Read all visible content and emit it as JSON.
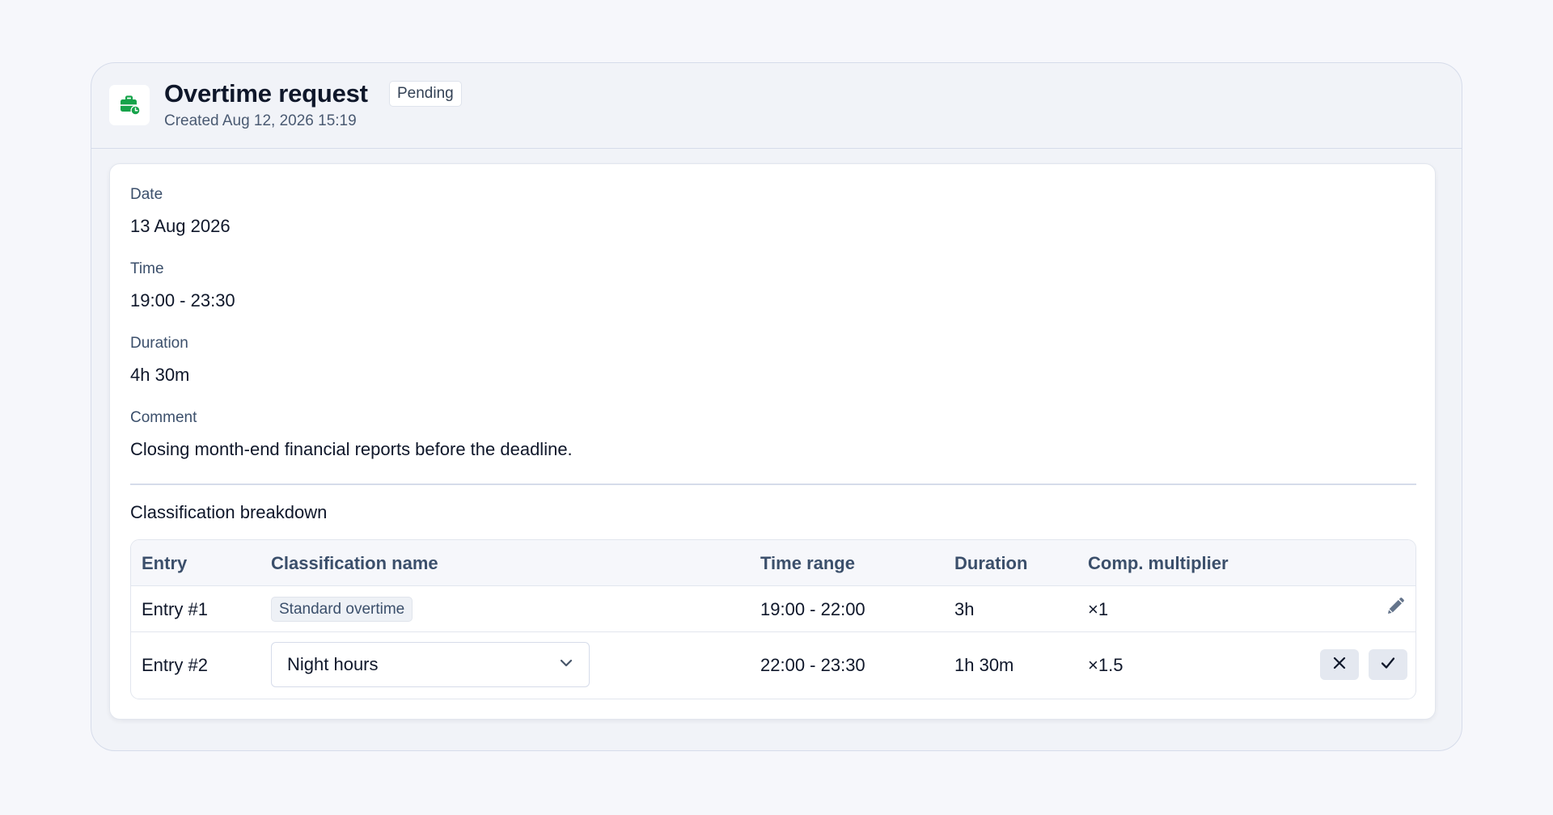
{
  "header": {
    "icon": "briefcase-clock-icon",
    "title": "Overtime request",
    "status": "Pending",
    "created": "Created Aug 12, 2026 15:19",
    "icon_color": "#16a34a"
  },
  "fields": {
    "date": {
      "label": "Date",
      "value": "13 Aug 2026"
    },
    "time": {
      "label": "Time",
      "value": "19:00 - 23:30"
    },
    "duration": {
      "label": "Duration",
      "value": "4h 30m"
    },
    "comment": {
      "label": "Comment",
      "value": "Closing month-end financial reports before the deadline."
    }
  },
  "breakdown": {
    "title": "Classification breakdown",
    "columns": [
      "Entry",
      "Classification name",
      "Time range",
      "Duration",
      "Comp. multiplier"
    ],
    "rows": [
      {
        "entry": "Entry #1",
        "classification": "Standard overtime",
        "time_range": "19:00 - 22:00",
        "duration": "3h",
        "multiplier": "×1",
        "action_icon": "pencil-icon"
      },
      {
        "entry": "Entry #2",
        "classification": "Night hours",
        "time_range": "22:00 - 23:30",
        "duration": "1h 30m",
        "multiplier": "×1.5",
        "action_icons": [
          "close-icon",
          "check-icon"
        ]
      }
    ]
  }
}
